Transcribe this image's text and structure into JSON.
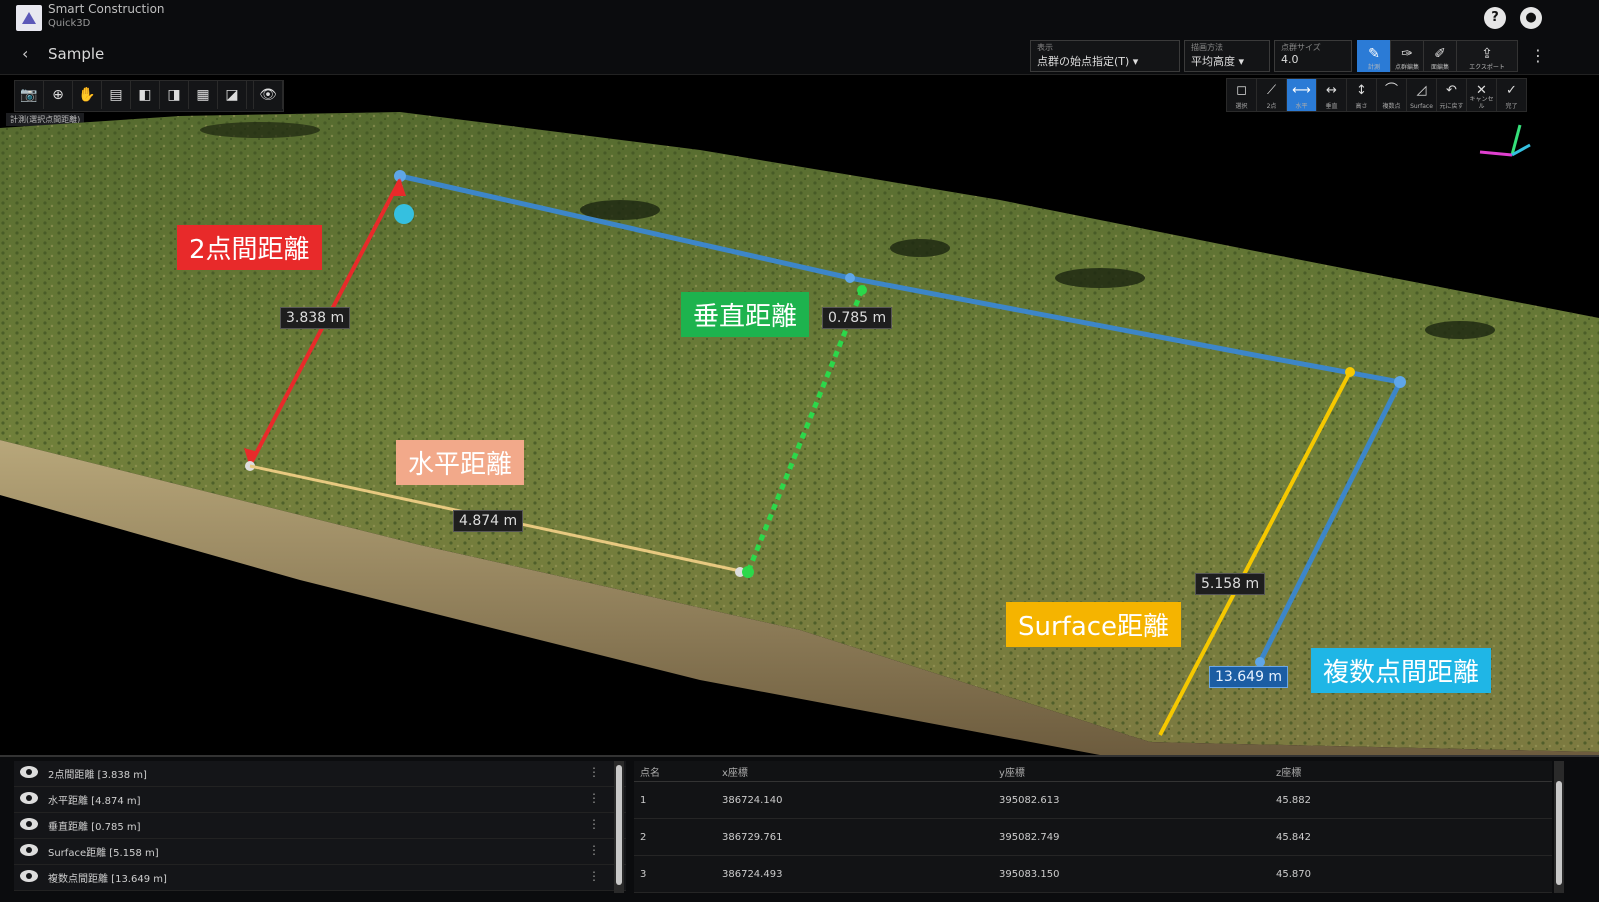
{
  "app": {
    "name": "Smart Construction",
    "subtitle": "Quick3D"
  },
  "nav": {
    "back_icon": "chevron-left-icon",
    "project": "Sample"
  },
  "header_controls": {
    "dropdowns": [
      {
        "label": "表示",
        "value": "点群の始点指定(T) ▾"
      },
      {
        "label": "描画方法",
        "value": "平均高度 ▾"
      },
      {
        "label": "点群サイズ",
        "value": "4.0"
      }
    ],
    "modes": [
      {
        "icon": "pencil-icon",
        "caption": "計測",
        "active": true
      },
      {
        "icon": "brush-icon",
        "caption": "点群編集",
        "active": false
      },
      {
        "icon": "edit-icon",
        "caption": "面編集",
        "active": false
      },
      {
        "icon": "export-icon",
        "caption": "エクスポート",
        "active": false
      }
    ]
  },
  "left_toolbar": {
    "tools": [
      "📷",
      "⊕",
      "✋",
      "▤",
      "◧",
      "◨",
      "▦",
      "◪",
      "👁"
    ],
    "caption": "計測(選択点間距離)"
  },
  "right_toolbar": {
    "tools": [
      {
        "glyph": "◻",
        "caption": "選択",
        "active": false
      },
      {
        "glyph": "⟋",
        "caption": "2点",
        "active": false
      },
      {
        "glyph": "⟷",
        "caption": "水平",
        "active": true
      },
      {
        "glyph": "↔",
        "caption": "垂直",
        "active": false
      },
      {
        "glyph": "↕",
        "caption": "高さ",
        "active": false
      },
      {
        "glyph": "⌒",
        "caption": "複数点",
        "active": false
      },
      {
        "glyph": "◿",
        "caption": "Surface",
        "active": false
      },
      {
        "glyph": "↶",
        "caption": "元に戻す",
        "active": false
      },
      {
        "glyph": "✕",
        "caption": "キャンセル",
        "active": false
      },
      {
        "glyph": "✓",
        "caption": "完了",
        "active": false
      }
    ]
  },
  "annotations": {
    "two_point": "2点間距離",
    "vertical": "垂直距離",
    "horizontal": "水平距離",
    "surface": "Surface距離",
    "multi_point": "複数点間距離"
  },
  "distances": {
    "two_point": "3.838 m",
    "vertical": "0.785 m",
    "horizontal": "4.874 m",
    "surface": "5.158 m",
    "multi_point": "13.649 m"
  },
  "colors": {
    "two_point": "#e82a2a",
    "vertical": "#1db34e",
    "horizontal": "#f2a98a",
    "surface": "#f5b400",
    "multi_point": "#1fb6e6",
    "path_blue": "#3d86c8"
  },
  "layers": [
    {
      "name": "2点間距離 [3.838 m]"
    },
    {
      "name": "水平距離 [4.874 m]"
    },
    {
      "name": "垂直距離 [0.785 m]"
    },
    {
      "name": "Surface距離 [5.158 m]"
    },
    {
      "name": "複数点間距離 [13.649 m]"
    }
  ],
  "points_table": {
    "columns": [
      "点名",
      "x座標",
      "y座標",
      "z座標"
    ],
    "rows": [
      [
        "1",
        "386724.140",
        "395082.613",
        "45.882"
      ],
      [
        "2",
        "386729.761",
        "395082.749",
        "45.842"
      ],
      [
        "3",
        "386724.493",
        "395083.150",
        "45.870"
      ]
    ]
  }
}
